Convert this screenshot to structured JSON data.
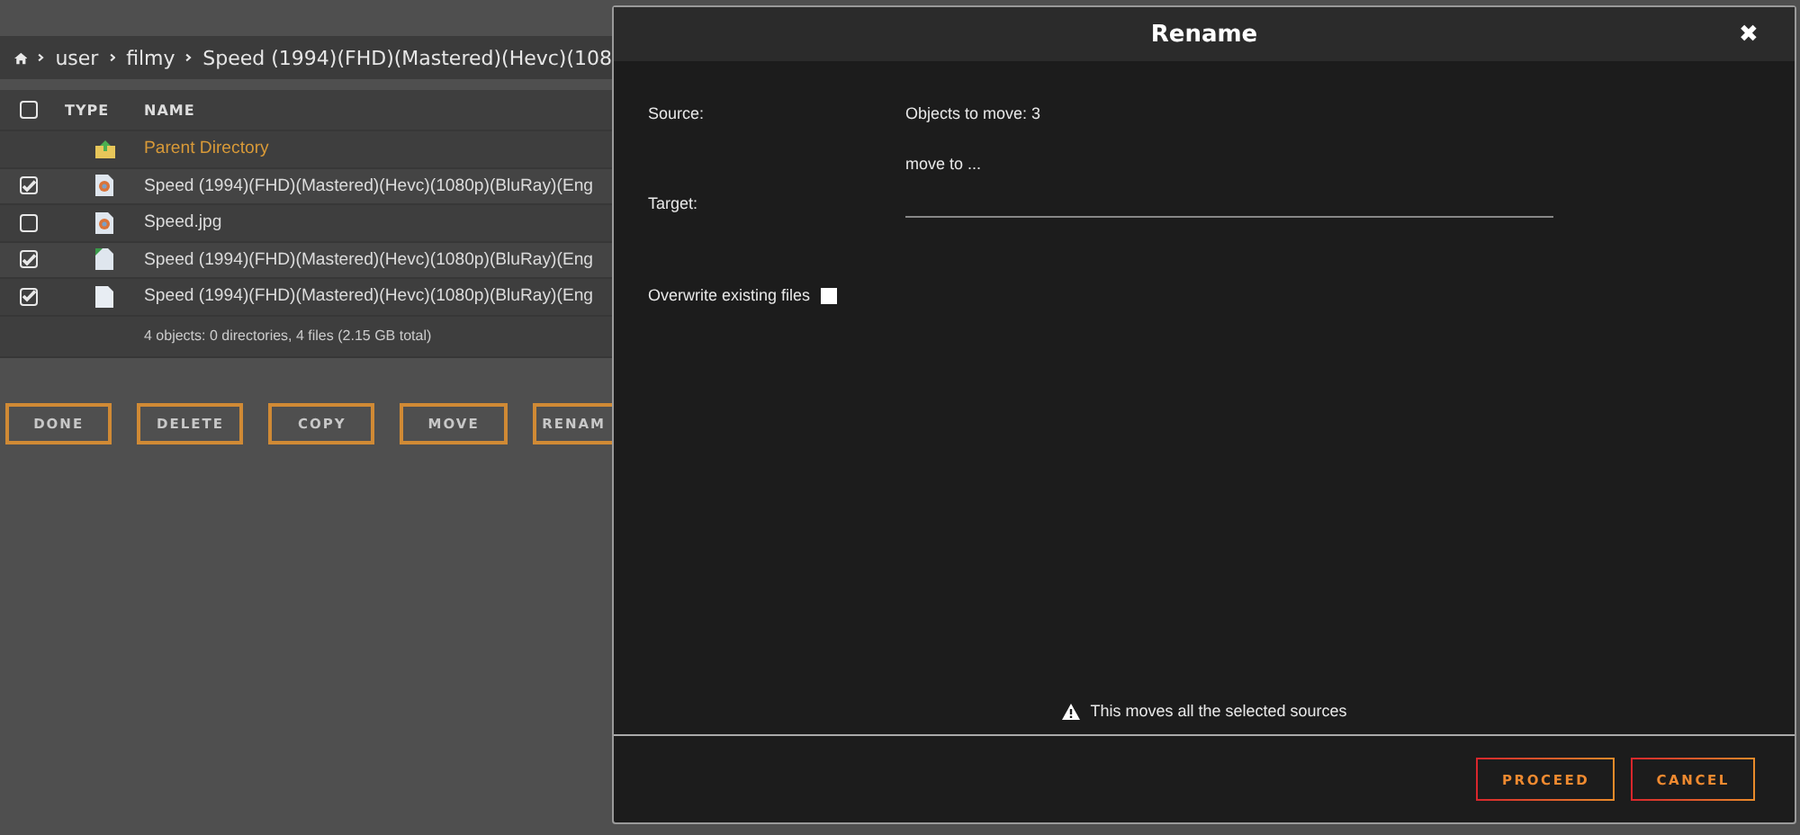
{
  "breadcrumb": [
    "user",
    "filmy",
    "Speed (1994)(FHD)(Mastered)(Hevc)(108"
  ],
  "table": {
    "columns": [
      "TYPE",
      "NAME"
    ],
    "all_checked": false,
    "rows": [
      {
        "kind": "parent",
        "name": "Parent Directory"
      },
      {
        "kind": "image",
        "name": "Speed (1994)(FHD)(Mastered)(Hevc)(1080p)(BluRay)(Eng",
        "checked": true
      },
      {
        "kind": "image",
        "name": "Speed.jpg",
        "checked": false
      },
      {
        "kind": "video",
        "name": "Speed (1994)(FHD)(Mastered)(Hevc)(1080p)(BluRay)(Eng",
        "checked": true
      },
      {
        "kind": "document",
        "name": "Speed (1994)(FHD)(Mastered)(Hevc)(1080p)(BluRay)(Eng",
        "checked": true
      }
    ],
    "summary": "4 objects: 0 directories, 4 files (2.15 GB total)"
  },
  "actions": [
    "DONE",
    "DELETE",
    "COPY",
    "MOVE",
    "RENAM"
  ],
  "dialog": {
    "title": "Rename",
    "close": "✖",
    "source_label": "Source:",
    "source_value": "Objects to move: 3",
    "target_hint": "move to ...",
    "target_label": "Target:",
    "overwrite_label": "Overwrite existing files",
    "overwrite_checked": false,
    "warning": "This moves all the selected sources",
    "buttons": [
      "PROCEED",
      "CANCEL"
    ]
  }
}
